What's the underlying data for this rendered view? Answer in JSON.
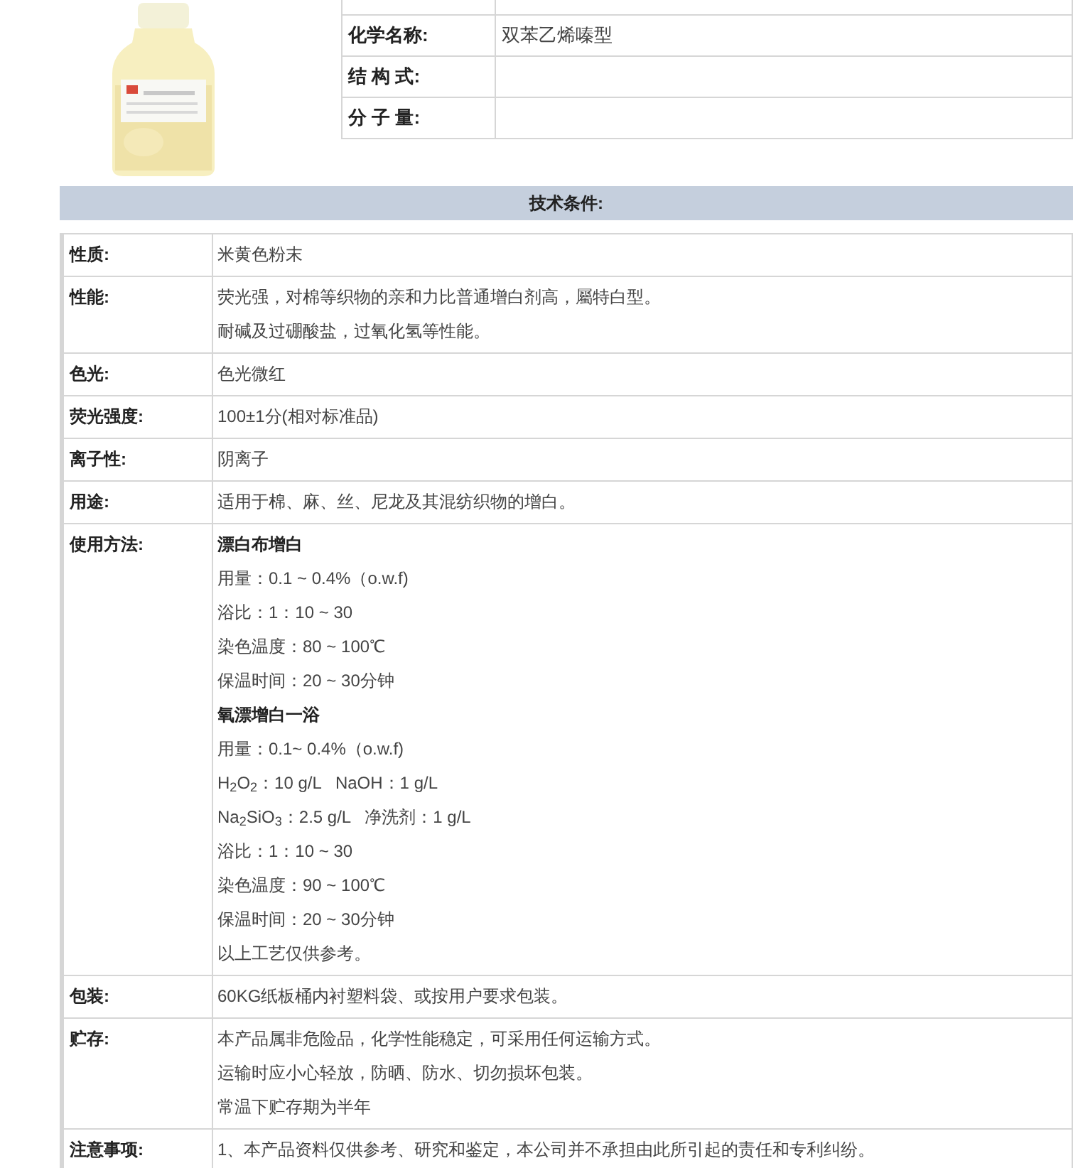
{
  "info_table": {
    "rows": [
      {
        "label": "化学名称:",
        "value": "双苯乙烯嗪型"
      },
      {
        "label": "结 构 式:",
        "value": ""
      },
      {
        "label": "分 子 量:",
        "value": ""
      }
    ]
  },
  "section_header": "技术条件:",
  "spec_table": {
    "rows": [
      {
        "label": "性质:",
        "lines": [
          {
            "kind": "plain",
            "text": "米黄色粉末"
          }
        ]
      },
      {
        "label": "性能:",
        "lines": [
          {
            "kind": "plain",
            "text": "荧光强，对棉等织物的亲和力比普通增白剂高，屬特白型。"
          },
          {
            "kind": "plain",
            "text": "耐碱及过硼酸盐，过氧化氢等性能。"
          }
        ]
      },
      {
        "label": "色光:",
        "lines": [
          {
            "kind": "plain",
            "text": "色光微红"
          }
        ]
      },
      {
        "label": "荧光强度:",
        "lines": [
          {
            "kind": "plain",
            "text": "100±1分(相对标准品)"
          }
        ]
      },
      {
        "label": "离子性:",
        "lines": [
          {
            "kind": "plain",
            "text": "阴离子"
          }
        ]
      },
      {
        "label": "用途:",
        "lines": [
          {
            "kind": "plain",
            "text": "适用于棉、麻、丝、尼龙及其混纺织物的增白。"
          }
        ]
      },
      {
        "label": "使用方法:",
        "lines": [
          {
            "kind": "heading",
            "text": "漂白布增白"
          },
          {
            "kind": "plain",
            "text": "用量：0.1 ~ 0.4%（o.w.f)"
          },
          {
            "kind": "plain",
            "text": "浴比：1：10 ~ 30"
          },
          {
            "kind": "plain",
            "text": "染色温度：80 ~ 100℃"
          },
          {
            "kind": "plain",
            "text": "保温时间：20 ~ 30分钟"
          },
          {
            "kind": "heading",
            "text": "氧漂增白一浴"
          },
          {
            "kind": "plain",
            "text": "用量：0.1~ 0.4%（o.w.f)"
          },
          {
            "kind": "plain",
            "text": "H$_{2}$O$_{2}$：10 g/L   NaOH：1 g/L"
          },
          {
            "kind": "plain",
            "text": "Na$_{2}$SiO$_{3}$：2.5 g/L   净洗剂：1 g/L"
          },
          {
            "kind": "plain",
            "text": "浴比：1：10 ~ 30"
          },
          {
            "kind": "plain",
            "text": "染色温度：90 ~ 100℃"
          },
          {
            "kind": "plain",
            "text": "保温时间：20 ~ 30分钟"
          },
          {
            "kind": "plain",
            "text": "以上工艺仅供参考。"
          }
        ]
      },
      {
        "label": "包装:",
        "lines": [
          {
            "kind": "plain",
            "text": "60KG纸板桶内衬塑料袋、或按用户要求包装。"
          }
        ]
      },
      {
        "label": "贮存:",
        "lines": [
          {
            "kind": "plain",
            "text": "本产品属非危险品，化学性能稳定，可采用任何运输方式。"
          },
          {
            "kind": "plain",
            "text": "运输时应小心轻放，防晒、防水、切勿损坏包装。"
          },
          {
            "kind": "plain",
            "text": "常温下贮存期为半年"
          }
        ]
      },
      {
        "label": "注意事项:",
        "lines": [
          {
            "kind": "plain",
            "text": "1、本产品资料仅供参考、研究和鉴定，本公司并不承担由此所引起的责任和专利纠纷。"
          }
        ]
      }
    ]
  }
}
